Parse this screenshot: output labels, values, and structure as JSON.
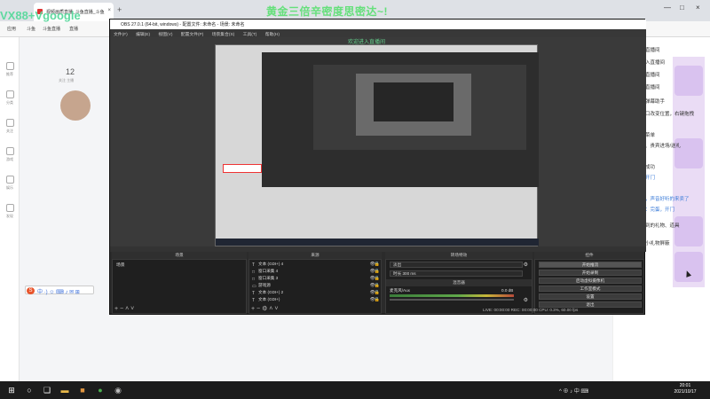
{
  "browser": {
    "tab_title": "视频画质直播_斗鱼直播_斗鱼",
    "new_tab_icon": "plus-icon",
    "bookmarks": [
      "应用",
      "斗鱼",
      "斗鱼直播",
      "直播"
    ]
  },
  "overlays": {
    "main_text": "黄金三倍辛密度思密达~!",
    "left_text": "VX88+Vgoogle",
    "mid_text": "欢迎进入直播间"
  },
  "site": {
    "host_count": "12",
    "host_sub": "关注 主播",
    "rail_items": [
      "推荐",
      "分类",
      "关注",
      "游戏",
      "娱乐",
      "发现"
    ]
  },
  "obs": {
    "title": "OBS 27.0.1 (64-bit, windows) - 配置文件: 未命名 - 场景: 未命名",
    "menu": [
      "文件(F)",
      "编辑(E)",
      "视图(V)",
      "配置文件(P)",
      "场景集合(S)",
      "工具(T)",
      "帮助(H)"
    ],
    "scene_label": "未选择源",
    "props_label": "属性",
    "filters_label": "滤镜",
    "dock_headers": {
      "scenes": "场景",
      "sources": "来源",
      "transitions": "转场特效",
      "mixer": "混音器",
      "controls": "控件"
    },
    "scenes": [
      "场景"
    ],
    "sources": [
      {
        "icon": "T",
        "name": "文本 (GDI+) 4"
      },
      {
        "icon": "□",
        "name": "窗口采集 4"
      },
      {
        "icon": "□",
        "name": "窗口采集 3"
      },
      {
        "icon": "▭",
        "name": "游戏源"
      },
      {
        "icon": "T",
        "name": "文本 (GDI+) 2"
      },
      {
        "icon": "T",
        "name": "文本 (GDI+)"
      }
    ],
    "transition_value": "淡出",
    "duration_label": "时长",
    "duration_value": "300 ms",
    "mixer_label": "麦克风/Aux",
    "mixer_db": "0.0 dB",
    "controls": [
      "开始推流",
      "开始录制",
      "启动虚拟摄像机",
      "工作室模式",
      "设置",
      "退出"
    ],
    "status": "LIVE: 00:00:00   REC: 00:00:00   CPU: 0.3%, 60.00 fps"
  },
  "chat": {
    "lines": [
      "欢迎热爱进入直播间",
      "欢迎追梦人进入直播间",
      "欢迎光线进入直播间",
      "欢迎守护进入直播间",
      "欢迎使用斗鱼弹幕助手",
      "左键拖拽此窗口改变位置，右键拖拽",
      "边框改变大小",
      "右上角有设置菜单",
      "这里展示弹幕、贵宾进场/送礼",
      "粉丝牌升级等",
      "添加弹幕助手成功",
      "我来大哥哥：开门",
      "底盘炮：开门",
      "恋我火：我来，声音好听的来卖了",
      "我天光的喵宝：完蛋，开门",
      "这里展示你收到的礼物、道具",
      "点菜单可设置小礼物屏蔽"
    ]
  },
  "taskbar": {
    "items": [
      "windows-logo-icon",
      "search-icon",
      "task-view-icon",
      "file-explorer-icon",
      "app-icon",
      "chrome-icon",
      "obs-icon"
    ],
    "tray_text": "^ ⊕ ♪ 中 ⌨",
    "time": "20:01",
    "date": "2021/10/17"
  },
  "colors": {
    "overlay_green": "#64e07a",
    "obs_bg": "#2b2b2b",
    "taskbar_bg": "#1c1c1c"
  }
}
